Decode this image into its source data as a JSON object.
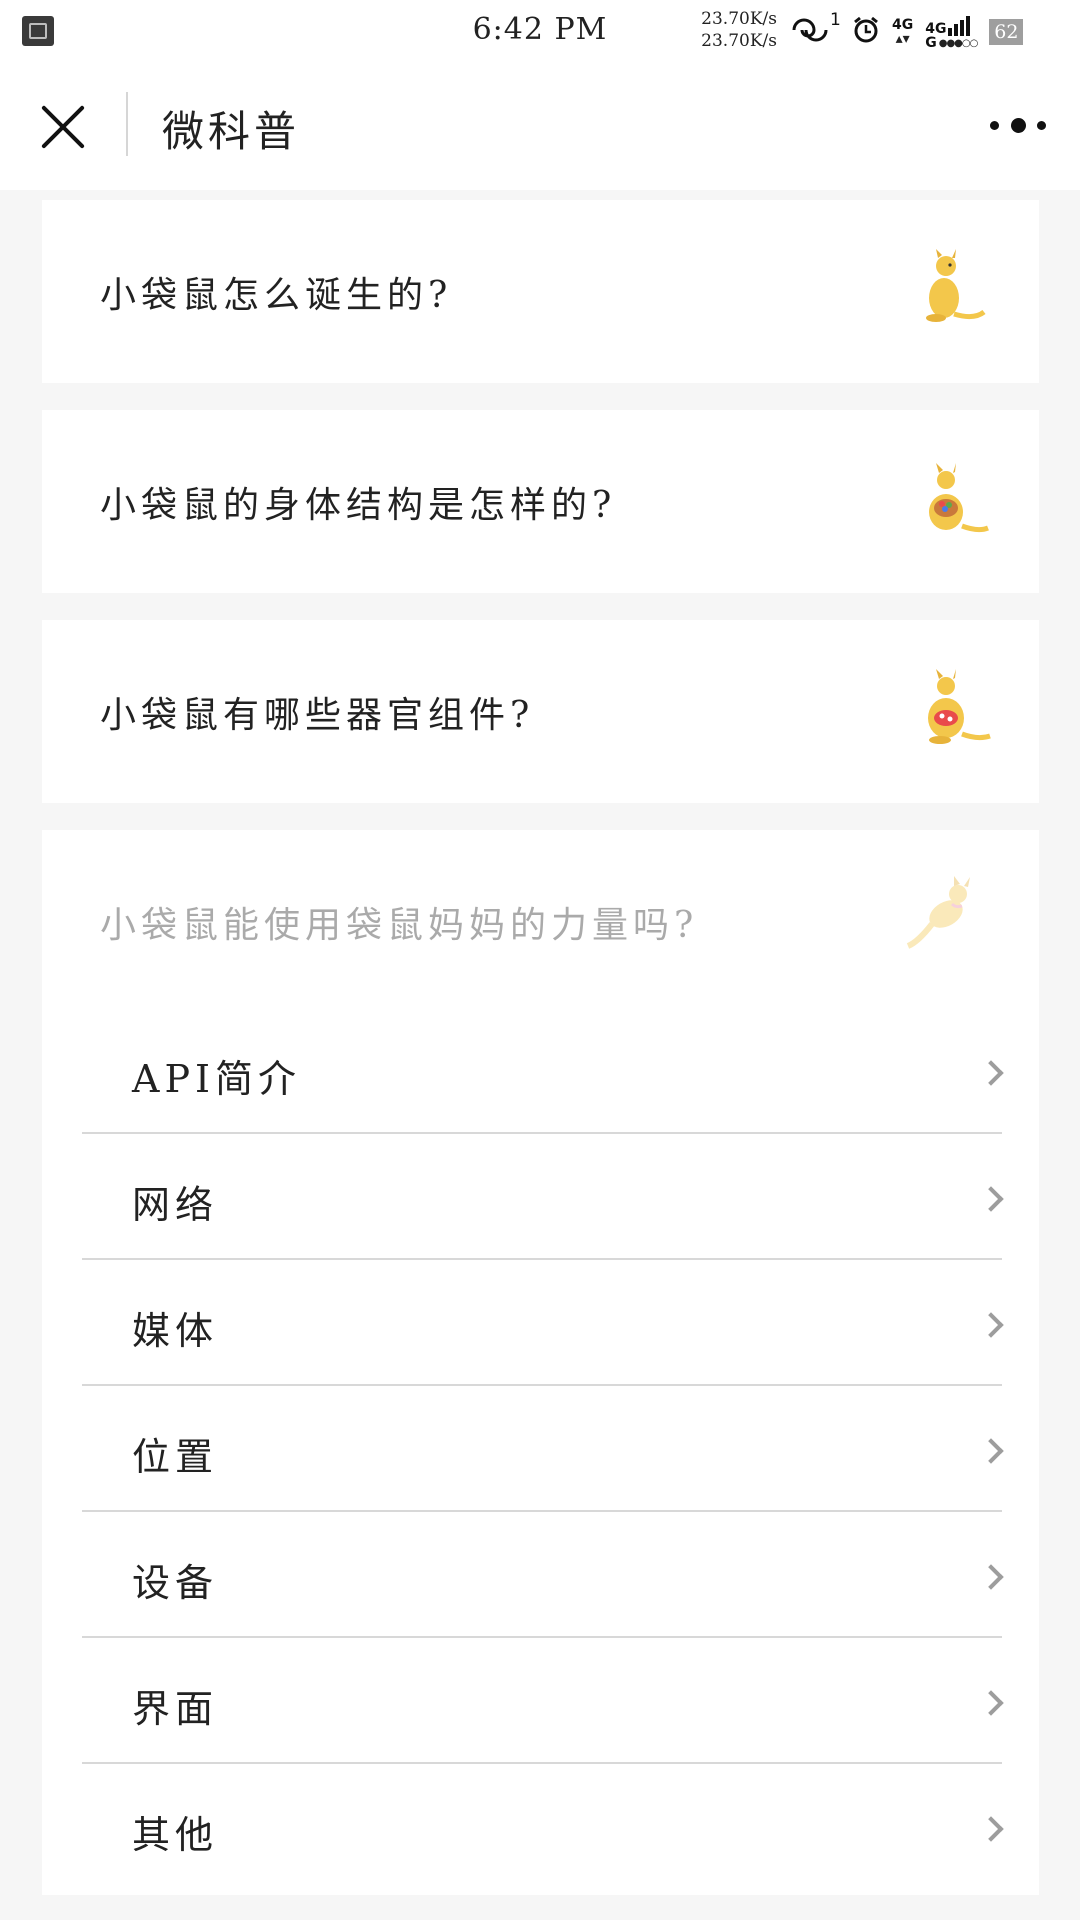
{
  "status_bar": {
    "time": "6:42 PM",
    "speed_up": "23.70K/s",
    "speed_down": "23.70K/s",
    "sim_badge": "1",
    "net1": "4G",
    "net2": "4G",
    "net2_sub": "G",
    "battery": "62",
    "icons": [
      "screenshot-icon",
      "hd-call-icon",
      "alarm-icon",
      "data-arrows-icon",
      "signal-icon",
      "battery-icon"
    ]
  },
  "navbar": {
    "title": "微科普",
    "close_icon": "close-icon",
    "more_icon": "more-dots-icon"
  },
  "cards": [
    {
      "title": "小袋鼠怎么诞生的?",
      "icon": "kangaroo-illustration"
    },
    {
      "title": "小袋鼠的身体结构是怎样的?",
      "icon": "kangaroo-basket-illustration"
    },
    {
      "title": "小袋鼠有哪些器官组件?",
      "icon": "kangaroo-pouch-illustration"
    },
    {
      "title": "小袋鼠能使用袋鼠妈妈的力量吗?",
      "icon": "kangaroo-jumping-illustration"
    }
  ],
  "menu": {
    "items": [
      {
        "label": "API简介"
      },
      {
        "label": "网络"
      },
      {
        "label": "媒体"
      },
      {
        "label": "位置"
      },
      {
        "label": "设备"
      },
      {
        "label": "界面"
      },
      {
        "label": "其他"
      }
    ]
  },
  "colors": {
    "background": "#f6f6f6",
    "card": "#ffffff",
    "kangaroo": "#f3c74b",
    "chevron": "#9d9d9d",
    "separator": "#d8d8d8"
  }
}
